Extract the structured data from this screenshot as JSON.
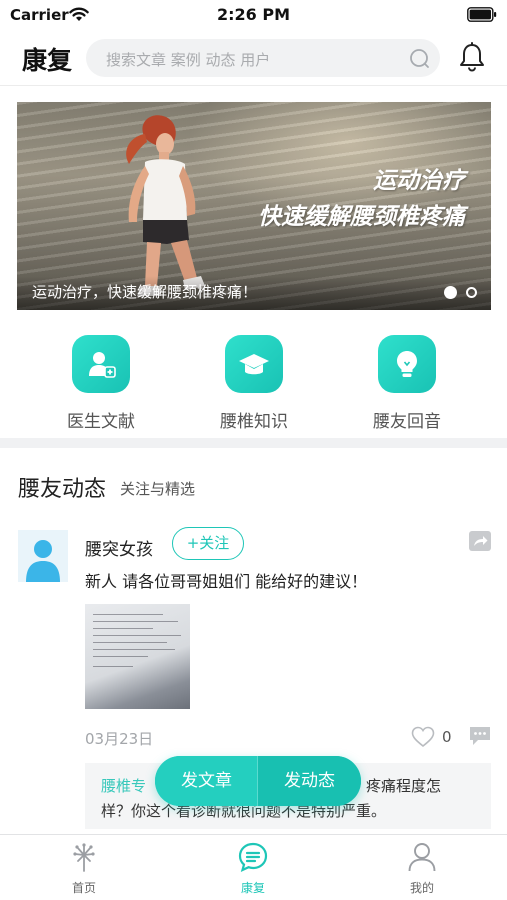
{
  "status_bar": {
    "carrier": "Carrier",
    "time": "2:26 PM"
  },
  "header": {
    "title": "康复",
    "search_placeholder": "搜索文章 案例 动态 用户"
  },
  "banner": {
    "headline_line1": "运动治疗",
    "headline_line2": "快速缓解腰颈椎疼痛",
    "caption": "运动治疗，快速缓解腰颈椎疼痛！",
    "current_slide": 1,
    "total_slides": 2
  },
  "quick_entries": [
    {
      "label": "医生文献",
      "icon": "doctor-icon"
    },
    {
      "label": "腰椎知识",
      "icon": "graduation-cap-icon"
    },
    {
      "label": "腰友回音",
      "icon": "lightbulb-icon"
    }
  ],
  "section": {
    "title": "腰友动态",
    "subtitle": "关注与精选"
  },
  "post": {
    "author": "腰突女孩",
    "follow_label": "+关注",
    "text": "新人  请各位哥哥姐姐们  能给好的建议！",
    "date": "03月23日",
    "like_count": "0",
    "comment": {
      "prefix": "腰椎专",
      "tail": "疼痛程度怎",
      "line2": "样？你这个看诊断就很问题不是特别严重。"
    }
  },
  "float_actions": {
    "post_article": "发文章",
    "post_status": "发动态"
  },
  "tab_bar": {
    "items": [
      {
        "label": "首页",
        "icon": "home-dandelion-icon",
        "active": false
      },
      {
        "label": "康复",
        "icon": "chat-list-icon",
        "active": true
      },
      {
        "label": "我的",
        "icon": "profile-icon",
        "active": false
      }
    ]
  },
  "colors": {
    "accent": "#1ec6b7",
    "muted_text": "#a3a6aa",
    "divider": "#f0f1f3"
  }
}
